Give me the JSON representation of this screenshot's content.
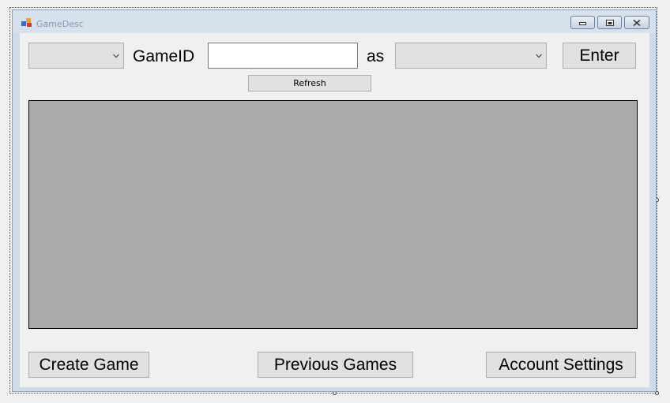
{
  "window": {
    "title": "GameDesc",
    "controls": {
      "minimize_icon": "minimize-icon",
      "maximize_icon": "maximize-icon",
      "close_icon": "close-icon"
    }
  },
  "toolbar": {
    "left_combo_value": "",
    "gameid_label": "GameID",
    "gameid_value": "",
    "as_label": "as",
    "as_combo_value": "",
    "enter_label": "Enter",
    "refresh_label": "Refresh"
  },
  "footer": {
    "create_game_label": "Create Game",
    "previous_games_label": "Previous Games",
    "account_settings_label": "Account Settings"
  }
}
